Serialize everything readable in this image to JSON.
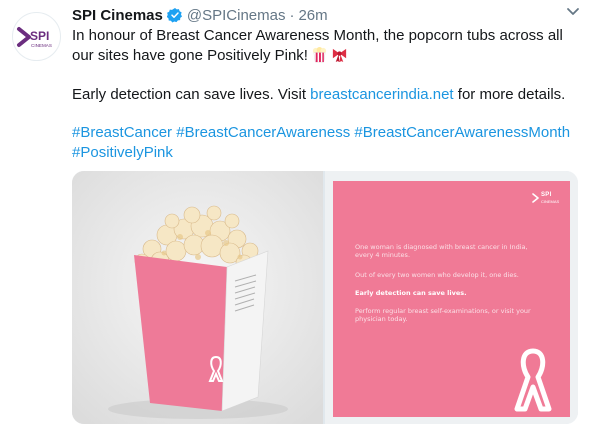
{
  "tweet": {
    "author": {
      "name": "SPI Cinemas",
      "handle": "@SPICinemas",
      "avatar_logo": "SPI",
      "avatar_sub": "CINEMAS"
    },
    "separator": "·",
    "time": "26m",
    "text_line1": "In honour of Breast Cancer Awareness Month, the popcorn tubs across all our sites have gone Positively Pink!",
    "text_line2_prefix": "Early detection can save lives. Visit ",
    "text_line2_link": "breastcancerindia.net",
    "text_line2_suffix": " for more details.",
    "hashtags": [
      "#BreastCancer",
      "#BreastCancerAwareness",
      "#BreastCancerAwarenessMonth",
      "#PositivelyPink"
    ],
    "emojis": [
      "popcorn-icon",
      "ribbon-icon"
    ]
  },
  "media": {
    "card_logo": "SPI",
    "card_logo_sub": "CINEMAS",
    "card_line1": "One woman is diagnosed with breast cancer in India, every 4 minutes.",
    "card_line2": "Out of every two women who develop it, one dies.",
    "card_line3": "Early detection can save lives.",
    "card_line4": "Perform regular breast self-examinations, or visit your physician today."
  },
  "colors": {
    "link": "#1b95e0",
    "pink": "#f07a96",
    "verified": "#1da1f2",
    "logo_purple": "#6b2d7f"
  }
}
